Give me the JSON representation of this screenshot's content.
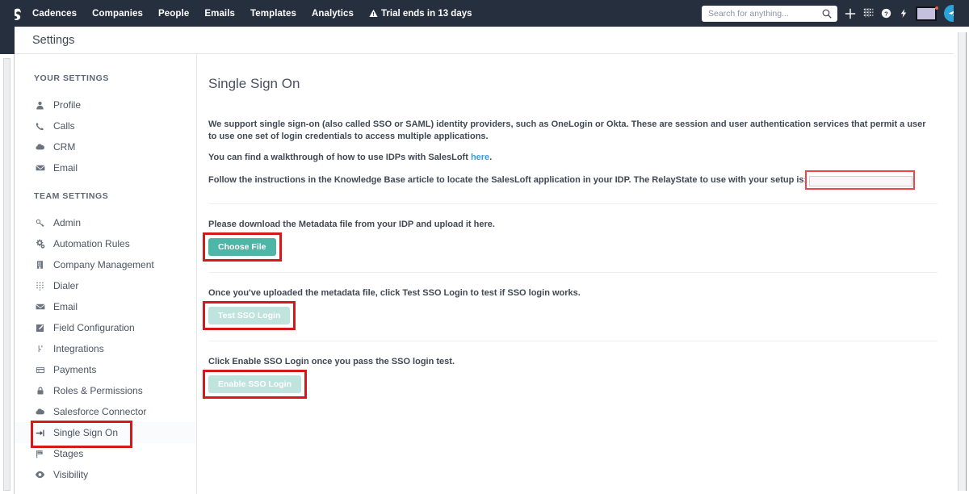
{
  "navbar": {
    "logo_icon": "salesloft-s-logo",
    "links": [
      {
        "label": "Cadences"
      },
      {
        "label": "Companies"
      },
      {
        "label": "People"
      },
      {
        "label": "Emails"
      },
      {
        "label": "Templates"
      },
      {
        "label": "Analytics"
      }
    ],
    "trial": {
      "icon": "warning-triangle-icon",
      "label": "Trial ends in 13 days"
    },
    "search": {
      "placeholder": "Search for anything...",
      "value": "",
      "icon": "search-icon"
    },
    "icons": [
      {
        "name": "add-plus-icon"
      },
      {
        "name": "dialer-grid-icon"
      },
      {
        "name": "help-circle-icon"
      },
      {
        "name": "lightning-bolt-icon"
      }
    ],
    "avatar": {
      "name": "user-avatar",
      "notification": true
    },
    "send_button": {
      "name": "send-plane-icon"
    }
  },
  "header": {
    "title": "Settings"
  },
  "sidebar": {
    "your_settings_label": "YOUR SETTINGS",
    "team_settings_label": "TEAM SETTINGS",
    "your_settings": [
      {
        "label": "Profile",
        "icon": "person-icon"
      },
      {
        "label": "Calls",
        "icon": "phone-icon"
      },
      {
        "label": "CRM",
        "icon": "cloud-icon"
      },
      {
        "label": "Email",
        "icon": "envelope-icon"
      }
    ],
    "team_settings": [
      {
        "label": "Admin",
        "icon": "key-icon"
      },
      {
        "label": "Automation Rules",
        "icon": "gears-icon"
      },
      {
        "label": "Company Management",
        "icon": "building-icon"
      },
      {
        "label": "Dialer",
        "icon": "dialpad-icon"
      },
      {
        "label": "Email",
        "icon": "envelope-icon"
      },
      {
        "label": "Field Configuration",
        "icon": "edit-square-icon"
      },
      {
        "label": "Integrations",
        "icon": "plug-icon"
      },
      {
        "label": "Payments",
        "icon": "credit-card-icon"
      },
      {
        "label": "Roles & Permissions",
        "icon": "lock-icon"
      },
      {
        "label": "Salesforce Connector",
        "icon": "cloud-icon"
      },
      {
        "label": "Single Sign On",
        "icon": "sign-in-icon",
        "active": true,
        "annotated": true
      },
      {
        "label": "Stages",
        "icon": "flag-icon"
      },
      {
        "label": "Visibility",
        "icon": "eye-icon"
      }
    ]
  },
  "main": {
    "page_title": "Single Sign On",
    "intro_paragraph": "We support single sign-on (also called SSO or SAML) identity providers, such as OneLogin or Okta. These are session and user authentication services that permit a user to use one set of login credentials to access multiple applications.",
    "walkthrough_prefix": "You can find a walkthrough of how to use IDPs with SalesLoft ",
    "walkthrough_link": "here",
    "walkthrough_suffix": ".",
    "relaystate_text": "Follow the instructions in the Knowledge Base article to locate the SalesLoft application in your IDP. The RelayState to use with your setup is:",
    "relaystate_value": "",
    "metadata_text": "Please download the Metadata file from your IDP and upload it here.",
    "choose_file_label": "Choose File",
    "test_text": "Once you've uploaded the metadata file, click Test SSO Login to test if SSO login works.",
    "test_sso_label": "Test SSO Login",
    "enable_text": "Click Enable SSO Login once you pass the SSO login test.",
    "enable_sso_label": "Enable SSO Login"
  },
  "colors": {
    "navbar_bg": "#252f3e",
    "primary_teal": "#4db6a7",
    "disabled_teal": "#bfe3dd",
    "link_blue": "#3a9ad9",
    "annotation_red": "#d31919",
    "send_blue": "#2aa3da"
  }
}
